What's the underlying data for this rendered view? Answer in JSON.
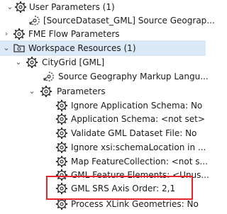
{
  "tree": {
    "rows": [
      {
        "label": "User Parameters (1)",
        "icon": "parameters-gear-icon",
        "expander": "chevron-down-icon"
      },
      {
        "label": "[SourceDataset_GML] Source Geograp...",
        "icon": "source-dataset-parameter-icon",
        "expander": ""
      },
      {
        "label": "FME Flow Parameters",
        "icon": "parameters-gear-icon",
        "expander": "chevron-right-icon"
      },
      {
        "label": "Workspace Resources (1)",
        "icon": "workspace-resources-icon",
        "expander": "chevron-down-icon"
      },
      {
        "label": "CityGrid [GML]",
        "icon": "reader-gear-icon",
        "expander": "chevron-down-icon"
      },
      {
        "label": "Source Geography Markup Langu...",
        "icon": "source-parameter-icon",
        "expander": ""
      },
      {
        "label": "Parameters",
        "icon": "parameters-gear-icon",
        "expander": "chevron-down-icon"
      },
      {
        "label": "Ignore Application Schema: No",
        "icon": "parameter-gear-icon",
        "expander": ""
      },
      {
        "label": "Application Schema: <not set>",
        "icon": "parameter-gear-icon",
        "expander": ""
      },
      {
        "label": "Validate GML Dataset File: No",
        "icon": "parameter-gear-icon",
        "expander": ""
      },
      {
        "label": "Ignore xsi:schemaLocation in ...",
        "icon": "parameter-gear-icon",
        "expander": ""
      },
      {
        "label": "Map FeatureCollection: <not s...",
        "icon": "parameter-gear-icon",
        "expander": ""
      },
      {
        "label": "GML Feature Elements: <Unus...",
        "icon": "parameter-gear-icon",
        "expander": ""
      },
      {
        "label": "GML SRS Axis Order: 2,1",
        "icon": "parameter-gear-icon",
        "expander": ""
      },
      {
        "label": "Process XLink Geometries: No",
        "icon": "parameter-gear-icon",
        "expander": ""
      }
    ]
  },
  "colors": {
    "selection": "#dbe9f7",
    "highlight_border": "#e4262b"
  }
}
